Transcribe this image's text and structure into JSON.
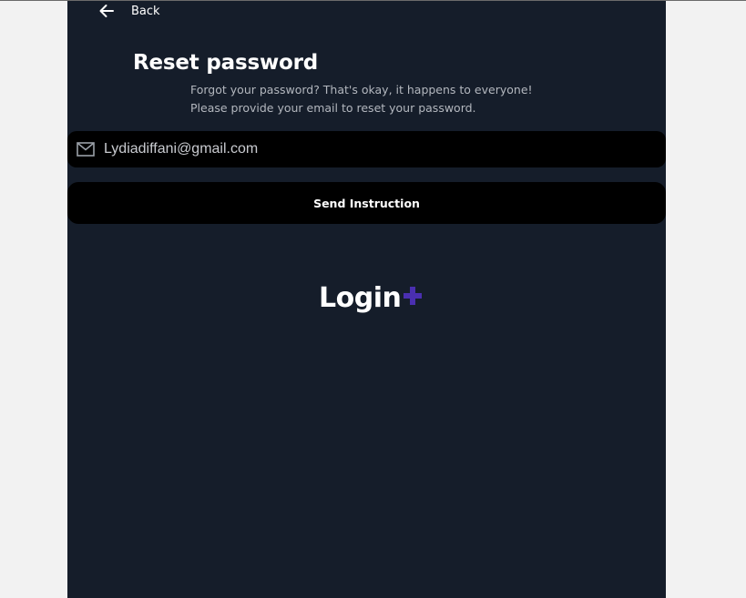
{
  "header": {
    "back_label": "Back",
    "back_icon": "arrow-left-icon"
  },
  "main": {
    "title": "Reset password",
    "subtitle_line1": "Forgot your password? That's okay, it happens to everyone!",
    "subtitle_line2": "Please provide your email to reset your password."
  },
  "form": {
    "email_value": "Lydiadiffani@gmail.com",
    "email_icon": "mail-icon",
    "submit_label": "Send Instruction"
  },
  "logo": {
    "text": "Login",
    "accent_icon": "plus-icon",
    "accent_color": "#4a2fb0"
  },
  "colors": {
    "background": "#151d2a",
    "field": "#000000",
    "caret": "#4b8cff"
  }
}
